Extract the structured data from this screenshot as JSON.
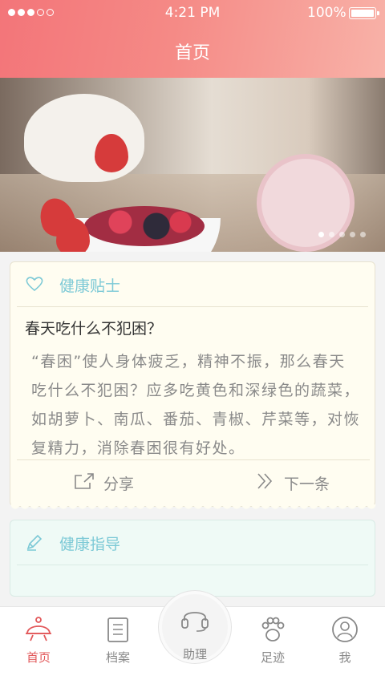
{
  "status": {
    "time": "4:21 PM",
    "battery": "100%"
  },
  "header": {
    "title": "首页"
  },
  "tip_card": {
    "title": "健康贴士",
    "question": "春天吃什么不犯困？",
    "body": "“春困”使人身体疲乏，精神不振，那么春天吃什么不犯困？应多吃黄色和深绿色的蔬菜，如胡萝卜、南瓜、番茄、青椒、芹菜等，对恢复精力，消除春困很有好处。",
    "share_label": "分享",
    "next_label": "下一条"
  },
  "guide_card": {
    "title": "健康指导"
  },
  "tabs": [
    {
      "label": "首页",
      "icon": "home-bell-icon"
    },
    {
      "label": "档案",
      "icon": "document-icon"
    },
    {
      "label": "助理",
      "icon": "headset-icon"
    },
    {
      "label": "足迹",
      "icon": "paw-icon"
    },
    {
      "label": "我",
      "icon": "user-icon"
    }
  ],
  "colors": {
    "header": "#f37579",
    "accent": "#7cc9d6",
    "active_tab": "#e2585a"
  }
}
